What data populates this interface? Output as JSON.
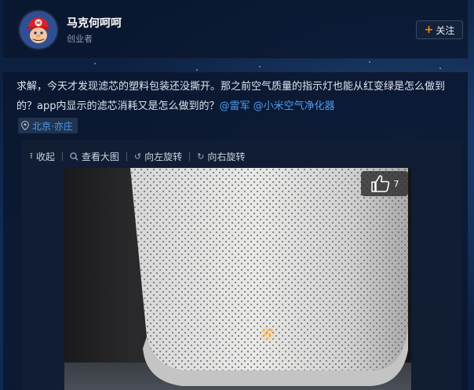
{
  "profile": {
    "username": "马克何呵呵",
    "title": "创业者",
    "follow_label": "关注"
  },
  "post": {
    "text_plain": "求解，今天才发现滤芯的塑料包装还没撕开。那之前空气质量的指示灯也能从红变绿是怎么做到的？app内显示的滤芯消耗又是怎么做到的？",
    "mention_1": "@雷军",
    "mention_2": "@小米空气净化器",
    "location": "北京·亦庄"
  },
  "media_toolbar": {
    "collapse": "收起",
    "view_large": "查看大图",
    "rotate_left": "向左旋转",
    "rotate_right": "向右旋转"
  },
  "photo": {
    "like_count": "7"
  },
  "colors": {
    "accent_orange": "#ff8200",
    "link_blue": "#4d9cf0"
  }
}
